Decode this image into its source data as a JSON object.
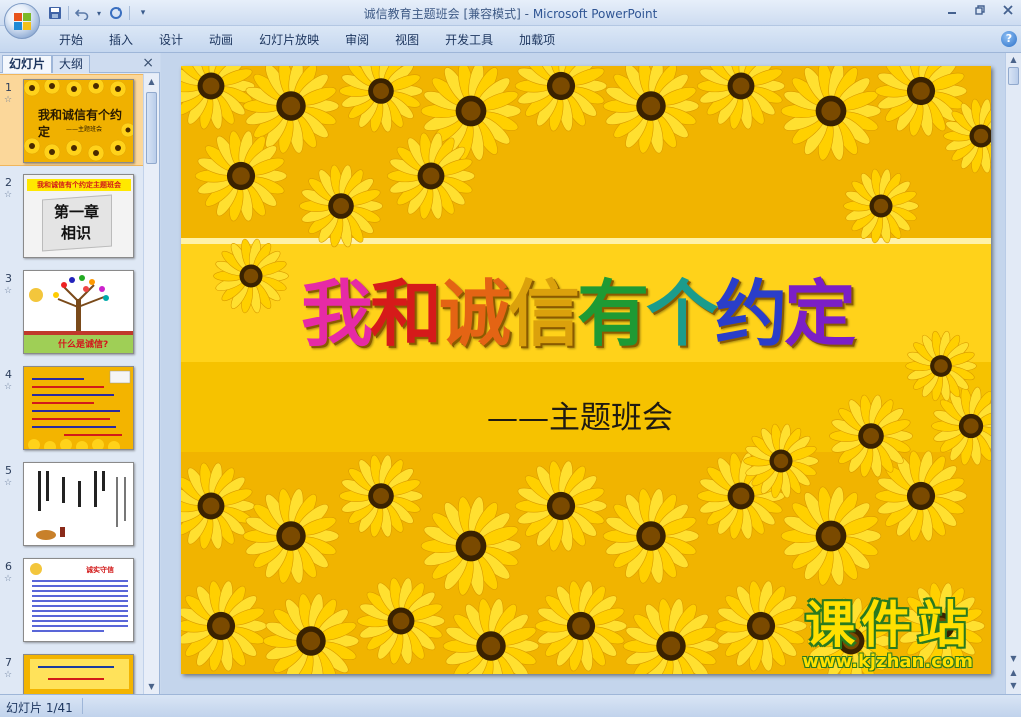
{
  "window": {
    "title_doc": "诚信教育主题班会 [兼容模式] - ",
    "title_app": "Microsoft PowerPoint"
  },
  "qat": {
    "icons": [
      "save-icon",
      "undo-icon",
      "redo-icon",
      "customize-icon"
    ]
  },
  "ribbon": {
    "tabs": [
      "开始",
      "插入",
      "设计",
      "动画",
      "幻灯片放映",
      "审阅",
      "视图",
      "开发工具",
      "加载项"
    ],
    "help_label": "?"
  },
  "leftpane": {
    "tab_slides": "幻灯片",
    "tab_outline": "大纲",
    "close_label": "×",
    "slides": [
      {
        "num": "1",
        "title": "我和诚信有个约定",
        "sub": "——主题班会"
      },
      {
        "num": "2",
        "title": "第一章",
        "sub": "相识",
        "header": "我和诚信有个约定主题班会"
      },
      {
        "num": "3",
        "title": "什么是诚信?"
      },
      {
        "num": "4",
        "title": ""
      },
      {
        "num": "5",
        "title": ""
      },
      {
        "num": "6",
        "title": "",
        "header": "诚实守信"
      },
      {
        "num": "7",
        "title": ""
      }
    ]
  },
  "slide": {
    "title_chars": [
      {
        "ch": "我",
        "color": "#e62aa6"
      },
      {
        "ch": "和",
        "color": "#d61a1a"
      },
      {
        "ch": "诚",
        "color": "#e46414"
      },
      {
        "ch": "信",
        "color": "#dba10c"
      },
      {
        "ch": "有",
        "color": "#1e9a34"
      },
      {
        "ch": "个",
        "color": "#1b9c8c"
      },
      {
        "ch": "约",
        "color": "#2a3ec9"
      },
      {
        "ch": "定",
        "color": "#7b1fc6"
      }
    ],
    "subtitle": "——主题班会",
    "watermark_big": "课件站",
    "watermark_url": "www.kjzhan.com"
  },
  "status": {
    "slide_counter": "幻灯片 1/41"
  }
}
